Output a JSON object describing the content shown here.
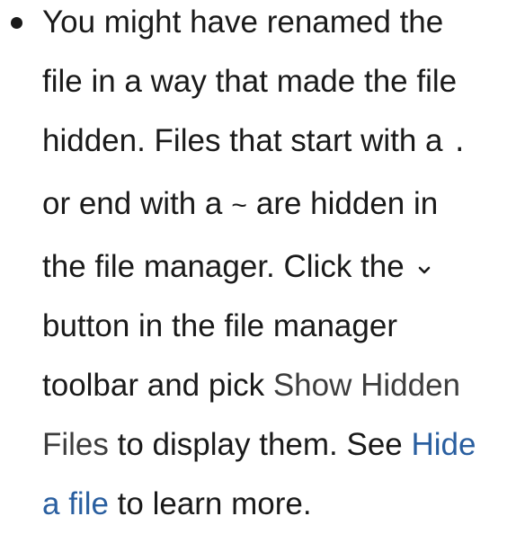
{
  "item": {
    "t1": "You might have renamed the file in a way that made the file hidden. Files that start with a ",
    "dot": ".",
    "t2": " or end with a ",
    "tilde": "~",
    "t3": " are hidden in the file manager. Click the ",
    "menu_icon": "pan-down-icon",
    "t4": " button in the file manager toolbar and pick ",
    "gui_label": "Show Hidden Files",
    "t5": " to display them. See ",
    "link_label": "Hide a file",
    "t6": " to learn more."
  }
}
